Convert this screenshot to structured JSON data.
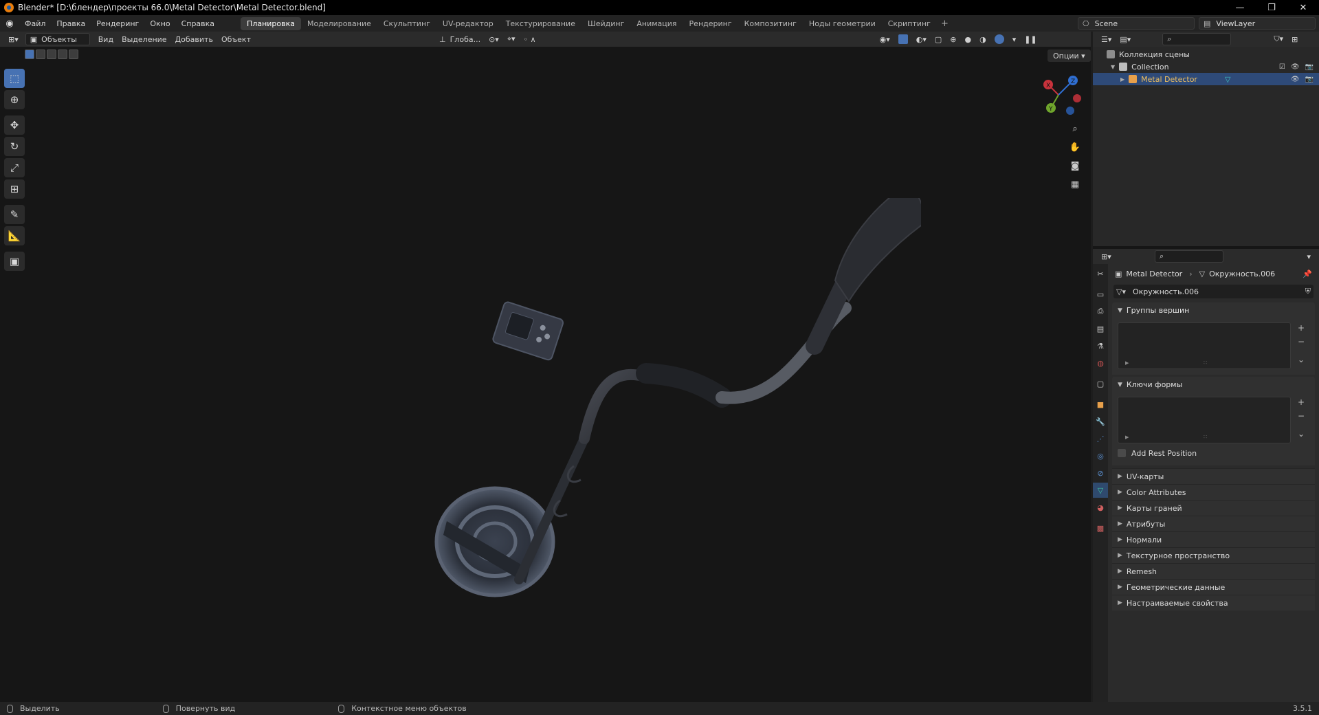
{
  "window": {
    "title": "Blender* [D:\\блендер\\проекты 66.0\\Metal Detector\\Metal Detector.blend]",
    "controls": [
      "—",
      "❐",
      "✕"
    ]
  },
  "menu": {
    "items": [
      "Файл",
      "Правка",
      "Рендеринг",
      "Окно",
      "Справка"
    ]
  },
  "workspaces": {
    "tabs": [
      "Планировка",
      "Моделирование",
      "Скульптинг",
      "UV-редактор",
      "Текстурирование",
      "Шейдинг",
      "Анимация",
      "Рендеринг",
      "Композитинг",
      "Ноды геометрии",
      "Скриптинг"
    ],
    "active_index": 0,
    "add": "+"
  },
  "scene": {
    "name": "Scene",
    "view_layer": "ViewLayer"
  },
  "viewport_header": {
    "mode": "Объекты",
    "menus": [
      "Вид",
      "Выделение",
      "Добавить",
      "Объект"
    ],
    "transform_orientation": "Глоба...",
    "options": "Опции"
  },
  "outliner": {
    "root": "Коллекция сцены",
    "collection": "Collection",
    "object": "Metal Detector"
  },
  "properties": {
    "breadcrumb_object": "Metal Detector",
    "breadcrumb_data": "Окружность.006",
    "mesh_name": "Окружность.006",
    "panels": {
      "vertex_groups": "Группы вершин",
      "shape_keys": "Ключи формы",
      "add_rest_position": "Add Rest Position"
    },
    "collapsed_panels": [
      "UV-карты",
      "Color Attributes",
      "Карты граней",
      "Атрибуты",
      "Нормали",
      "Текстурное пространство",
      "Remesh",
      "Геометрические данные",
      "Настраиваемые свойства"
    ]
  },
  "statusbar": {
    "select": "Выделить",
    "rotate": "Повернуть вид",
    "context": "Контекстное меню объектов",
    "version": "3.5.1"
  },
  "gizmo": {
    "x": "X",
    "y": "Y",
    "z": "Z"
  },
  "colors": {
    "accent": "#4772b3",
    "x_axis": "#c8323c",
    "y_axis": "#6fa52c",
    "z_axis": "#2f6ed1"
  }
}
